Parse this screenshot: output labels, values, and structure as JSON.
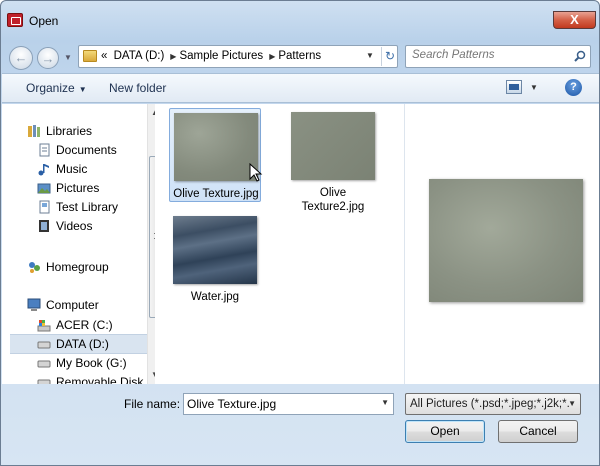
{
  "window": {
    "title": "Open",
    "close_label": "X"
  },
  "address": {
    "overflow": "«",
    "crumbs": [
      "DATA (D:)",
      "Sample Pictures",
      "Patterns"
    ]
  },
  "search": {
    "placeholder": "Search Patterns"
  },
  "toolbar": {
    "organize": "Organize",
    "new_folder": "New folder",
    "help": "?"
  },
  "nav": {
    "items": [
      {
        "label": "Libraries",
        "icon": "libraries-icon"
      },
      {
        "label": "Documents",
        "icon": "documents-icon"
      },
      {
        "label": "Music",
        "icon": "music-icon"
      },
      {
        "label": "Pictures",
        "icon": "pictures-icon"
      },
      {
        "label": "Test Library",
        "icon": "library-icon"
      },
      {
        "label": "Videos",
        "icon": "videos-icon"
      },
      {
        "label": "Homegroup",
        "icon": "homegroup-icon"
      },
      {
        "label": "Computer",
        "icon": "computer-icon"
      },
      {
        "label": "ACER (C:)",
        "icon": "drive-icon"
      },
      {
        "label": "DATA (D:)",
        "icon": "drive-icon"
      },
      {
        "label": "My Book (G:)",
        "icon": "drive-icon"
      },
      {
        "label": "Removable Disk (",
        "icon": "removable-disk-icon"
      }
    ],
    "selected": "DATA (D:)"
  },
  "files": [
    {
      "name": "Olive Texture.jpg",
      "selected": true
    },
    {
      "name": "Olive Texture2.jpg",
      "selected": false
    },
    {
      "name": "Water.jpg",
      "selected": false
    }
  ],
  "bottom": {
    "file_name_label": "File name:",
    "file_name_value": "Olive Texture.jpg",
    "file_type": "All Pictures (*.psd;*.jpeg;*.j2k;*.",
    "open": "Open",
    "cancel": "Cancel"
  },
  "colors": {
    "selection": "#cfe2f7",
    "close": "#d46148",
    "toolbar": "#e1eaf4"
  }
}
